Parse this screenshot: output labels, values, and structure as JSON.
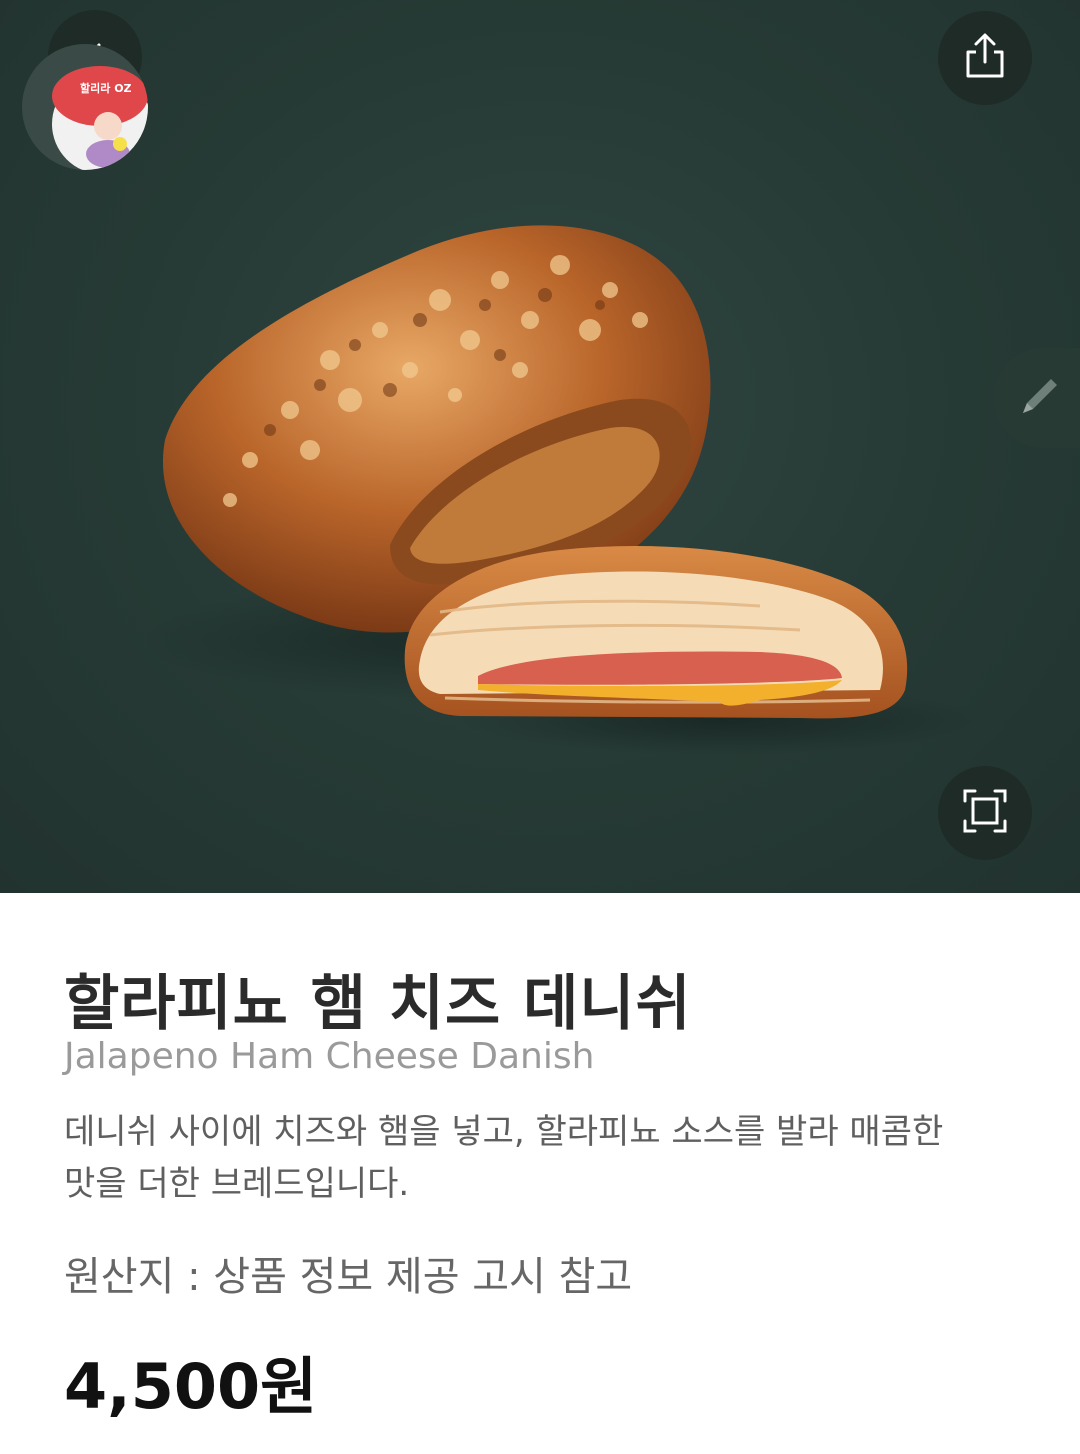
{
  "header": {
    "back_icon": "chevron-left-icon",
    "share_icon": "share-icon",
    "zoom_icon": "fullscreen-icon",
    "edit_icon": "pencil-icon"
  },
  "hero": {
    "image": "jalapeno-ham-cheese-danish-photo",
    "background_color": "#263a35"
  },
  "avatar": {
    "badge_text": "할리라 OZ"
  },
  "product": {
    "name_ko": "할라피뇨 햄 치즈 데니쉬",
    "name_en": "Jalapeno Ham Cheese Danish",
    "description": "데니쉬 사이에 치즈와 햄을 넣고, 할라피뇨 소스를 발라 매콤한 맛을 더한 브레드입니다.",
    "origin": "원산지 : 상품 정보 제공 고시 참고",
    "price": "4,500원"
  }
}
